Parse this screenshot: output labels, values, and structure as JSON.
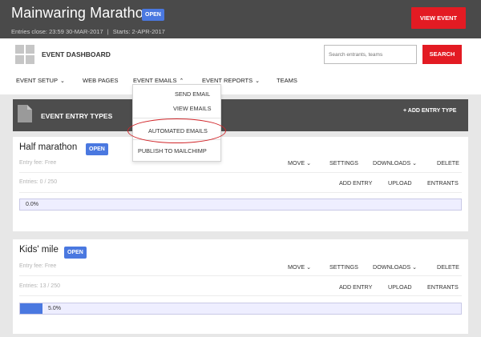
{
  "header": {
    "event_title": "Mainwaring Marathon",
    "status_badge": "OPEN",
    "entries_close": "Entries close: 23:59 30-MAR-2017",
    "separator": "|",
    "starts": "Starts: 2-APR-2017",
    "view_event_label": "VIEW EVENT",
    "accent_color": "#e31b23"
  },
  "dashboard": {
    "title": "EVENT DASHBOARD",
    "icon": "grid-icon",
    "search_placeholder": "Search entrants, teams",
    "search_label": "SEARCH"
  },
  "nav": {
    "items": [
      {
        "label": "EVENT SETUP",
        "has_dropdown": true
      },
      {
        "label": "WEB PAGES",
        "has_dropdown": false
      },
      {
        "label": "EVENT EMAILS",
        "has_dropdown": true,
        "open": true
      },
      {
        "label": "EVENT REPORTS",
        "has_dropdown": true
      },
      {
        "label": "TEAMS",
        "has_dropdown": false
      }
    ]
  },
  "emails_menu": {
    "items": [
      {
        "label": "SEND EMAIL"
      },
      {
        "label": "VIEW EMAILS"
      },
      {
        "label": "AUTOMATED EMAILS",
        "highlighted": true
      },
      {
        "label": "PUBLISH TO MAILCHIMP"
      }
    ],
    "highlight_color": "#d1262a"
  },
  "entry_types": {
    "title": "EVENT ENTRY TYPES",
    "add_label": "+ ADD ENTRY TYPE",
    "cards": [
      {
        "title": "Half marathon",
        "badge": "OPEN",
        "fee": "Entry fee: Free",
        "entries": "Entries: 0 / 250",
        "progress": 0.0,
        "progress_label": "0.0%",
        "actions_top": [
          "MOVE",
          "SETTINGS",
          "DOWNLOADS",
          "DELETE"
        ],
        "actions_bottom": [
          "ADD ENTRY",
          "UPLOAD",
          "ENTRANTS"
        ]
      },
      {
        "title": "Kids' mile",
        "badge": "OPEN",
        "fee": "Entry fee: Free",
        "entries": "Entries: 13 / 250",
        "progress": 0.05,
        "progress_label": "5.0%",
        "actions_top": [
          "MOVE",
          "SETTINGS",
          "DOWNLOADS",
          "DELETE"
        ],
        "actions_bottom": [
          "ADD ENTRY",
          "UPLOAD",
          "ENTRANTS"
        ]
      }
    ]
  }
}
